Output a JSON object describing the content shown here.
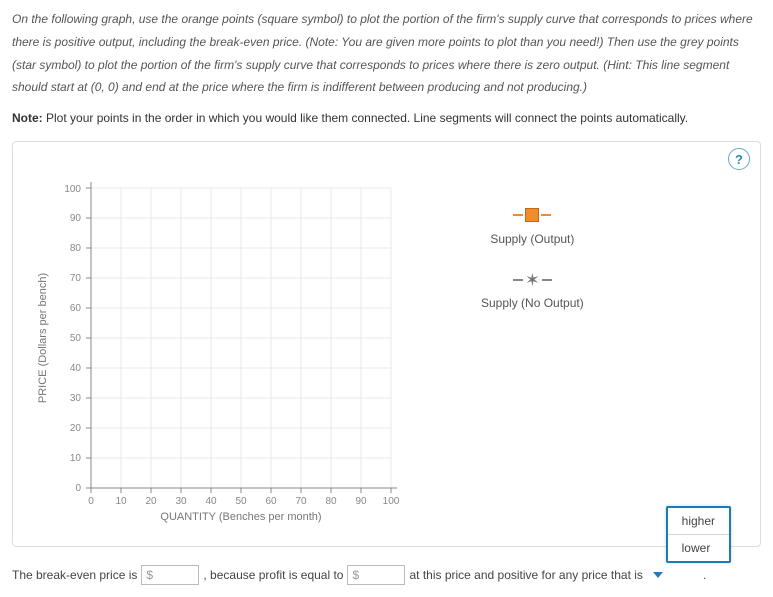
{
  "instructions": "On the following graph, use the orange points (square symbol) to plot the portion of the firm's supply curve that corresponds to prices where there is positive output, including the break-even price. (Note: You are given more points to plot than you need!) Then use the grey points (star symbol) to plot the portion of the firm's supply curve that corresponds to prices where there is zero output. (Hint: This line segment should start at (0, 0) and end at the price where the firm is indifferent between producing and not producing.)",
  "note_prefix": "Note:",
  "note_text": " Plot your points in the order in which you would like them connected. Line segments will connect the points automatically.",
  "help_label": "?",
  "legend": {
    "output": "Supply (Output)",
    "no_output": "Supply (No Output)"
  },
  "chart_data": {
    "type": "scatter",
    "title": "",
    "xlabel": "QUANTITY (Benches per month)",
    "ylabel": "PRICE (Dollars per bench)",
    "x_ticks": [
      0,
      10,
      20,
      30,
      40,
      50,
      60,
      70,
      80,
      90,
      100
    ],
    "y_ticks": [
      0,
      10,
      20,
      30,
      40,
      50,
      60,
      70,
      80,
      90,
      100
    ],
    "xlim": [
      0,
      100
    ],
    "ylim": [
      0,
      100
    ],
    "series": [
      {
        "name": "Supply (Output)",
        "symbol": "square",
        "color": "#f08c2e",
        "values": []
      },
      {
        "name": "Supply (No Output)",
        "symbol": "star",
        "color": "#888888",
        "values": []
      }
    ],
    "grid": true
  },
  "fill": {
    "t1": "The break-even price is",
    "currency1": "$",
    "t2": ", because profit is equal to",
    "currency2": "$",
    "t3": "at this price and positive for any price that is",
    "period": "."
  },
  "dropdown": {
    "options": [
      "higher",
      "lower"
    ]
  }
}
